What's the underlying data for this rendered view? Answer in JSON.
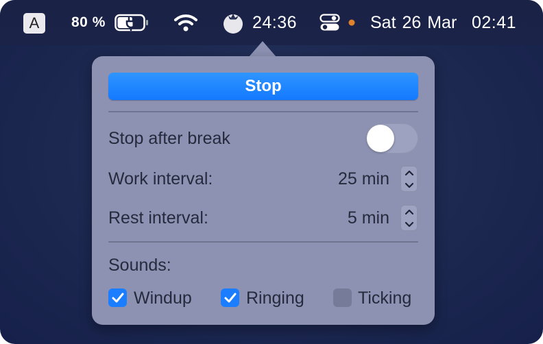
{
  "menubar": {
    "input_source": "A",
    "battery_percent": "80 %",
    "timer": "24:36",
    "date": "Sat 26 Mar",
    "time": "02:41",
    "icons": {
      "battery": "battery-charging-icon",
      "wifi": "wifi-icon",
      "app": "tomato-icon",
      "control_center": "control-center-icon",
      "indicator": "orange-dot-icon"
    },
    "indicator_color": "#e0822b"
  },
  "popover": {
    "stop_label": "Stop",
    "stop_after_break": {
      "label": "Stop after break",
      "enabled": false
    },
    "work_interval": {
      "label": "Work interval:",
      "value": "25 min"
    },
    "rest_interval": {
      "label": "Rest interval:",
      "value": "5 min"
    },
    "sounds": {
      "label": "Sounds:",
      "options": [
        {
          "label": "Windup",
          "checked": true
        },
        {
          "label": "Ringing",
          "checked": true
        },
        {
          "label": "Ticking",
          "checked": false
        }
      ]
    }
  },
  "colors": {
    "accent": "#1479ff",
    "popover_bg": "#8d92b3",
    "menubar_bg": "#1a2246"
  }
}
